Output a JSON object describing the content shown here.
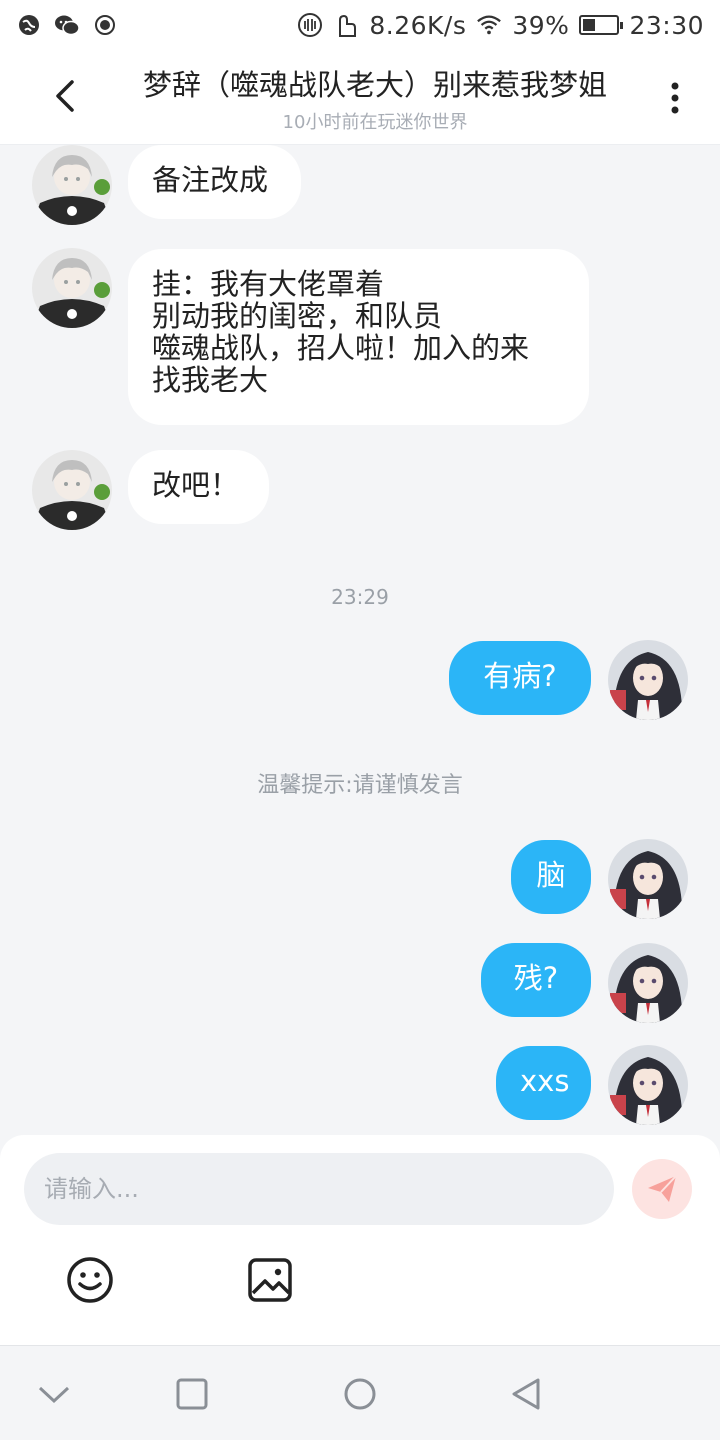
{
  "status_bar": {
    "speed": "8.26K/s",
    "battery": "39%",
    "battery_level": 0.39,
    "time": "23:30"
  },
  "header": {
    "title": "梦辞（噬魂战队老大）别来惹我梦姐",
    "subtitle": "10小时前在玩迷你世界"
  },
  "messages": [
    {
      "side": "in",
      "lines": [
        "备注改成"
      ]
    },
    {
      "side": "in",
      "lines": [
        "挂：我有大佬罩着",
        "别动我的闺密，和队员",
        "噬魂战队，招人啦！加入的来",
        "找我老大"
      ]
    },
    {
      "side": "in",
      "lines": [
        "改吧！"
      ]
    },
    {
      "side": "out",
      "lines": [
        "有病?"
      ]
    },
    {
      "side": "out",
      "lines": [
        "脑"
      ]
    },
    {
      "side": "out",
      "lines": [
        "残?"
      ]
    },
    {
      "side": "out",
      "lines": [
        "xxs"
      ]
    }
  ],
  "timestamp": "23:29",
  "tip": "温馨提示:请谨慎发言",
  "composer": {
    "placeholder": "请输入..."
  },
  "colors": {
    "outgoing_bubble": "#2bb5f7",
    "incoming_bubble": "#ffffff",
    "background": "#f4f5f7",
    "send_button": "#fde3e1",
    "send_icon": "#f7a19b"
  },
  "icons": {
    "back": "chevron-left-icon",
    "more": "more-vertical-icon",
    "send": "paper-plane-icon",
    "emoji": "smiley-icon",
    "image": "image-icon"
  }
}
